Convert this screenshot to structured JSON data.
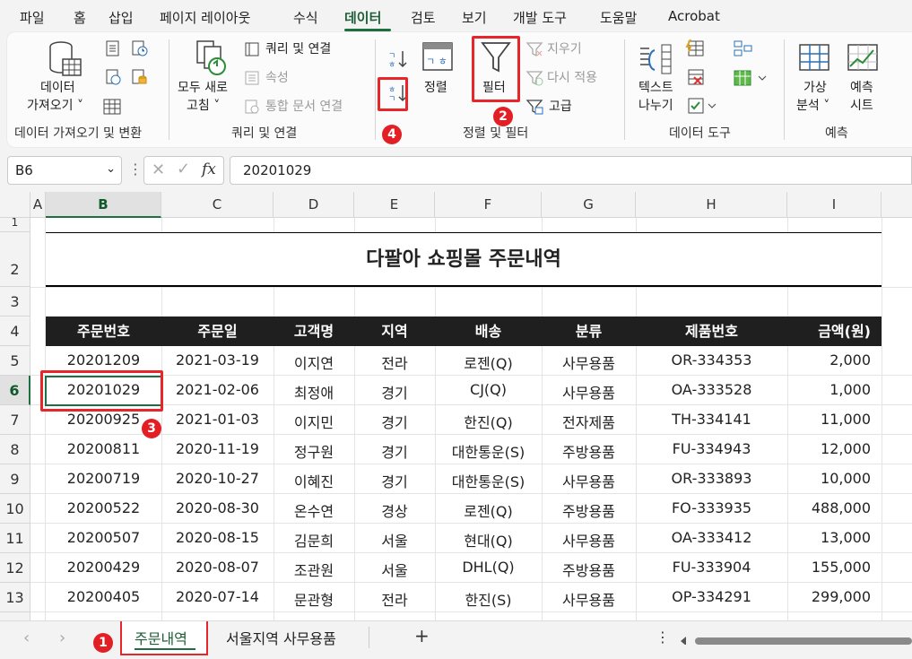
{
  "menu": {
    "tabs": [
      "파일",
      "홈",
      "삽입",
      "페이지 레이아웃",
      "수식",
      "데이터",
      "검토",
      "보기",
      "개발 도구",
      "도움말",
      "Acrobat"
    ],
    "active": "데이터"
  },
  "ribbon": {
    "get_data": {
      "line1": "데이터",
      "line2": "가져오기 ˅"
    },
    "refresh": {
      "line1": "모두 새로",
      "line2": "고침 ˅"
    },
    "query_conn": "쿼리 및 연결",
    "properties": "속성",
    "edit_links": "통합 문서 연결",
    "sort": "정렬",
    "filter": "필터",
    "clear": "지우기",
    "reapply": "다시 적용",
    "advanced": "고급",
    "text_to_columns": {
      "line1": "텍스트",
      "line2": "나누기"
    },
    "what_if": {
      "line1": "가상",
      "line2": "분석 ˅"
    },
    "forecast": {
      "line1": "예측",
      "line2": "시트"
    },
    "groups": {
      "get_transform": "데이터 가져오기 및 변환",
      "queries": "쿼리 및 연결",
      "sort_filter": "정렬 및 필터",
      "data_tools": "데이터 도구",
      "forecast": "예측"
    }
  },
  "badges": {
    "b1": "1",
    "b2": "2",
    "b3": "3",
    "b4": "4"
  },
  "formula_bar": {
    "name_box": "B6",
    "fx": "fx",
    "content": "20201029"
  },
  "columns": [
    "A",
    "B",
    "C",
    "D",
    "E",
    "F",
    "G",
    "H",
    "I"
  ],
  "rows": [
    "1",
    "2",
    "3",
    "4",
    "5",
    "6",
    "7",
    "8",
    "9",
    "10",
    "11",
    "12",
    "13"
  ],
  "sheet": {
    "title": "다팔아 쇼핑몰 주문내역",
    "headers": [
      "주문번호",
      "주문일",
      "고객명",
      "지역",
      "배송",
      "분류",
      "제품번호",
      "금액(원)"
    ],
    "data": [
      [
        "20201209",
        "2021-03-19",
        "이지연",
        "전라",
        "로젠(Q)",
        "사무용품",
        "OR-334353",
        "2,000"
      ],
      [
        "20201029",
        "2021-02-06",
        "최정애",
        "경기",
        "CJ(Q)",
        "사무용품",
        "OA-333528",
        "1,000"
      ],
      [
        "20200925",
        "2021-01-03",
        "이지민",
        "경기",
        "한진(Q)",
        "전자제품",
        "TH-334141",
        "11,000"
      ],
      [
        "20200811",
        "2020-11-19",
        "정구원",
        "경기",
        "대한통운(S)",
        "주방용품",
        "FU-334943",
        "12,000"
      ],
      [
        "20200719",
        "2020-10-27",
        "이혜진",
        "경기",
        "대한통운(S)",
        "사무용품",
        "OR-333893",
        "10,000"
      ],
      [
        "20200522",
        "2020-08-30",
        "온수연",
        "경상",
        "로젠(Q)",
        "주방용품",
        "FO-333935",
        "488,000"
      ],
      [
        "20200507",
        "2020-08-15",
        "김문희",
        "서울",
        "현대(Q)",
        "사무용품",
        "OA-333412",
        "13,000"
      ],
      [
        "20200429",
        "2020-08-07",
        "조관원",
        "서울",
        "DHL(Q)",
        "주방용품",
        "FU-333904",
        "155,000"
      ],
      [
        "20200405",
        "2020-07-14",
        "문관형",
        "전라",
        "한진(S)",
        "사무용품",
        "OP-334291",
        "299,000"
      ]
    ]
  },
  "sheet_tabs": {
    "active": "주문내역",
    "other": "서울지역 사무용품",
    "add": "+"
  }
}
